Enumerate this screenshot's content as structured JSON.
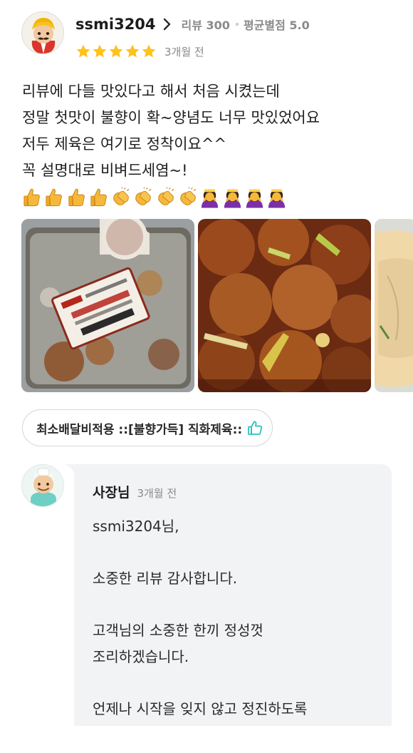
{
  "reviewer": {
    "username": "ssmi3204",
    "review_count": "리뷰 300",
    "avg_rating": "평균별점 5.0",
    "stars": 5,
    "date": "3개월 전"
  },
  "review": {
    "lines": [
      "리뷰에 다들 맛있다고 해서 처음 시켰는데",
      "정말 첫맛이 불향이 확~양념도 너무 맛있었어요",
      "저두 제육은 여기로 정착이요^^",
      "꼭 설명대로 비벼드세염~!"
    ],
    "emojis": [
      "thumbs-up",
      "thumbs-up",
      "thumbs-up",
      "thumbs-up",
      "clapping-hands",
      "clapping-hands",
      "clapping-hands",
      "clapping-hands",
      "person-bowing",
      "person-bowing",
      "person-bowing",
      "person-bowing"
    ]
  },
  "photos": [
    {
      "icon": "packaged-food-photo"
    },
    {
      "icon": "spicy-pork-photo"
    },
    {
      "icon": "side-dish-photo"
    }
  ],
  "menu_tag": {
    "label": "최소배달비적용 ::[불향가득] 직화제육::",
    "icon": "thumbs-up-outline-icon"
  },
  "owner_reply": {
    "name": "사장님",
    "date": "3개월 전",
    "lines": [
      "ssmi3204님,",
      "",
      "소중한 리뷰 감사합니다.",
      "",
      "고객님의 소중한 한끼 정성껏",
      "조리하겠습니다.",
      "",
      "언제나 시작을 잊지 않고 정진하도록"
    ]
  },
  "colors": {
    "star": "#ffc21a",
    "accent_teal": "#2ac1bc",
    "reply_bg": "#f2f3f5"
  }
}
